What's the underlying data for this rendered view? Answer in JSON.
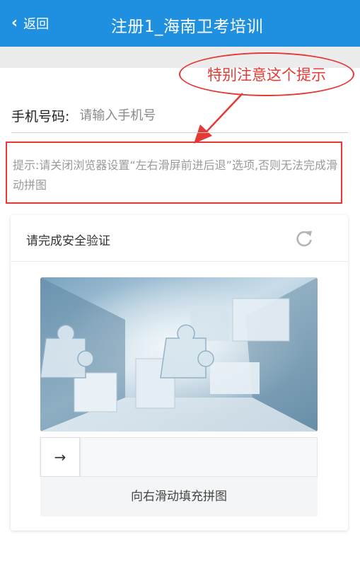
{
  "header": {
    "back_label": "返回",
    "title": "注册1_海南卫考培训",
    "color": "#1f8fe0"
  },
  "annotation": {
    "callout_text": "特别注意这个提示",
    "color": "#e53935"
  },
  "form": {
    "phone_label": "手机号码:",
    "phone_placeholder": "请输入手机号",
    "phone_value": ""
  },
  "tip": {
    "text": "提示:请关闭浏览器设置“左右滑屏前进后退”选项,否则无法完成滑动拼图"
  },
  "captcha": {
    "title": "请完成安全验证",
    "refresh_icon": "refresh-icon",
    "slider_icon": "arrow-right-icon",
    "slider_arrow": "→",
    "slider_hint": "向右滑动填充拼图"
  },
  "icons": {
    "back": "chevron-left-icon",
    "back_glyph": "‹"
  }
}
